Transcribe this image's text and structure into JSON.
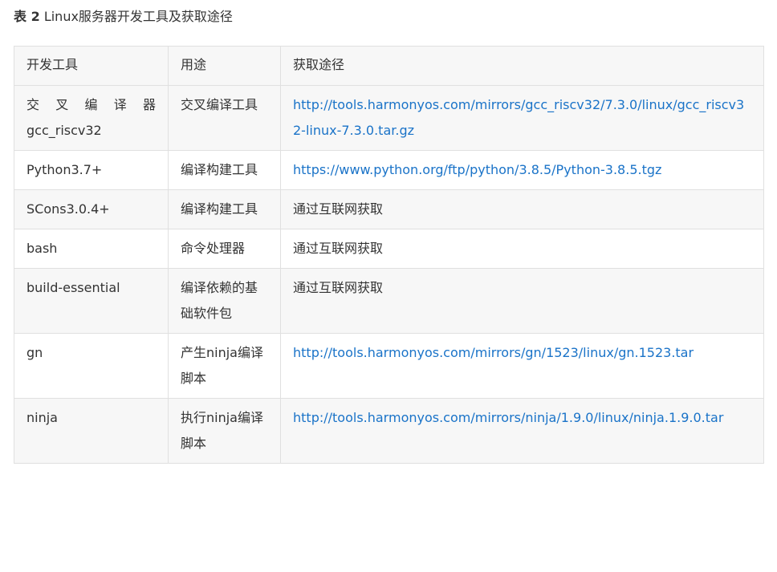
{
  "caption": {
    "label": "表 2",
    "text": "Linux服务器开发工具及获取途径"
  },
  "table": {
    "headers": [
      "开发工具",
      "用途",
      "获取途径"
    ],
    "rows": [
      {
        "tool_line1": "交叉编译器",
        "tool_line2": "gcc_riscv32",
        "purpose": "交叉编译工具",
        "source": "http://tools.harmonyos.com/mirrors/gcc_riscv32/7.3.0/linux/gcc_riscv32-linux-7.3.0.tar.gz",
        "source_is_link": true
      },
      {
        "tool": "Python3.7+",
        "purpose": "编译构建工具",
        "source": "https://www.python.org/ftp/python/3.8.5/Python-3.8.5.tgz",
        "source_is_link": true
      },
      {
        "tool": "SCons3.0.4+",
        "purpose": "编译构建工具",
        "source": "通过互联网获取",
        "source_is_link": false
      },
      {
        "tool": "bash",
        "purpose": "命令处理器",
        "source": "通过互联网获取",
        "source_is_link": false
      },
      {
        "tool": "build-essential",
        "purpose": "编译依赖的基础软件包",
        "source": "通过互联网获取",
        "source_is_link": false
      },
      {
        "tool": "gn",
        "purpose": "产生ninja编译脚本",
        "source": "http://tools.harmonyos.com/mirrors/gn/1523/linux/gn.1523.tar",
        "source_is_link": true
      },
      {
        "tool": "ninja",
        "purpose": "执行ninja编译脚本",
        "source": "http://tools.harmonyos.com/mirrors/ninja/1.9.0/linux/ninja.1.9.0.tar",
        "source_is_link": true
      }
    ]
  },
  "colors": {
    "text": "#333333",
    "link": "#1a73c8",
    "border": "#e0e0e0",
    "stripe": "#f7f7f7"
  }
}
